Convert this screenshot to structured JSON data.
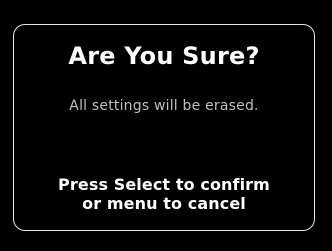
{
  "dialog": {
    "title": "Are You Sure?",
    "message": "All settings will be erased.",
    "instructions": {
      "line1": "Press Select to confirm",
      "line2": "or menu to cancel"
    }
  },
  "colors": {
    "background": "#000000",
    "border": "#e6e6e6",
    "title": "#ffffff",
    "message": "#bfbfbf",
    "instructions": "#ffffff"
  }
}
